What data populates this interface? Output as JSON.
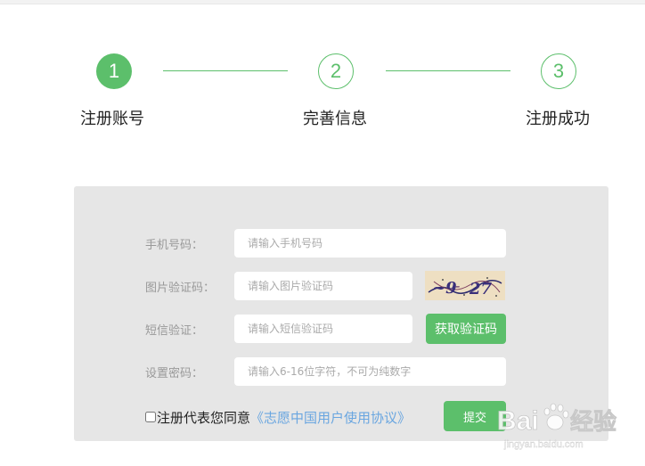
{
  "steps": [
    {
      "number": "1",
      "label": "注册账号",
      "state": "active"
    },
    {
      "number": "2",
      "label": "完善信息",
      "state": "inactive"
    },
    {
      "number": "3",
      "label": "注册成功",
      "state": "inactive"
    }
  ],
  "form": {
    "phone": {
      "label": "手机号码：",
      "placeholder": "请输入手机号码"
    },
    "image_code": {
      "label": "图片验证码：",
      "placeholder": "请输入图片验证码"
    },
    "sms_code": {
      "label": "短信验证：",
      "placeholder": "请输入短信验证码",
      "button": "获取验证码"
    },
    "password": {
      "label": "设置密码：",
      "placeholder": "请输入6-16位字符，不可为纯数字"
    },
    "agreement": {
      "text": "注册代表您同意",
      "link": "《志愿中国用户使用协议》"
    },
    "submit": "提交"
  },
  "watermark": {
    "brand": "Bai",
    "suffix": "经验",
    "url": "jingyan.baidu.com"
  },
  "colors": {
    "accent": "#5cbf6b",
    "panel": "#e6e6e6",
    "link": "#6aa6e0"
  }
}
